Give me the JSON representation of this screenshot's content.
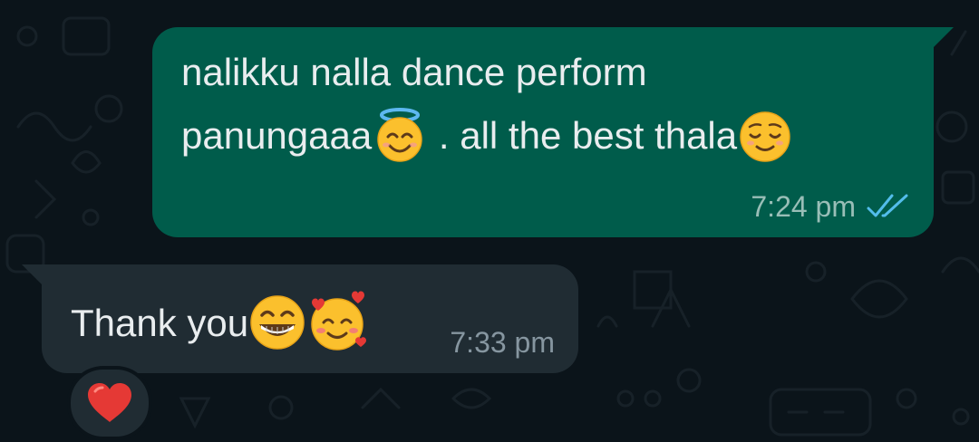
{
  "outgoing_message": {
    "line1": "nalikku nalla dance perform",
    "line2_part1": "panungaaa",
    "line2_part2": " . all the best thala",
    "emojis": [
      "smiling-face-with-halo",
      "relieved-face"
    ],
    "time": "7:24 pm",
    "status": "read",
    "bubble_color": "#005c4b",
    "tick_color": "#53bdeb"
  },
  "incoming_message": {
    "text": "Thank you",
    "emojis": [
      "beaming-face-with-smiling-eyes",
      "smiling-face-with-hearts"
    ],
    "time": "7:33 pm",
    "bubble_color": "#202c33"
  },
  "reaction": {
    "emoji": "red-heart"
  }
}
